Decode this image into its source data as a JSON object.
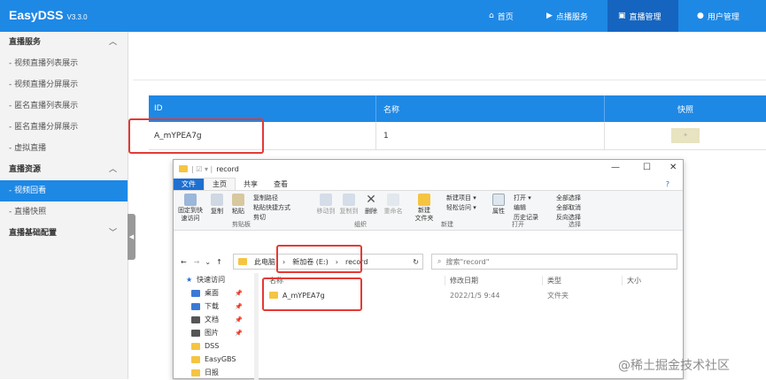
{
  "app": {
    "name": "EasyDSS",
    "version": "V3.3.0"
  },
  "nav": [
    {
      "label": "首页",
      "icon": "home-icon"
    },
    {
      "label": "点播服务",
      "icon": "video-icon"
    },
    {
      "label": "直播管理",
      "icon": "live-icon",
      "active": true
    },
    {
      "label": "用户管理",
      "icon": "user-icon"
    }
  ],
  "sidebar": {
    "sec1": "直播服务",
    "items1": [
      "- 视频直播列表展示",
      "- 视频直播分屏展示",
      "- 匿名直播列表展示",
      "- 匿名直播分屏展示",
      "- 虚拟直播"
    ],
    "sec2": "直播资源",
    "items2": [
      "- 视频回看",
      "- 直播快照"
    ],
    "sec3": "直播基础配置"
  },
  "table": {
    "headers": [
      "ID",
      "名称",
      "快照"
    ],
    "rows": [
      {
        "id": "A_mYPEA7g",
        "name": "1"
      }
    ]
  },
  "explorer": {
    "title": "record",
    "tabs": [
      "文件",
      "主页",
      "共享",
      "查看"
    ],
    "ribbon": {
      "pin": "固定到快\n速访问",
      "copy": "复制",
      "paste": "粘贴",
      "copy_path": "复制路径",
      "paste_shortcut": "粘贴快捷方式",
      "cut": "剪切",
      "move_to": "移动到",
      "copy_to": "复制到",
      "delete": "删除",
      "rename": "重命名",
      "new_folder": "新建\n文件夹",
      "new_item": "新建项目 ▾",
      "easy_access": "轻松访问 ▾",
      "properties": "属性",
      "open": "打开 ▾",
      "edit": "编辑",
      "history": "历史记录",
      "select_all": "全部选择",
      "select_none": "全部取消",
      "invert": "反向选择",
      "groups": [
        "剪贴板",
        "组织",
        "新建",
        "打开",
        "选择"
      ]
    },
    "address": [
      "此电脑",
      "新加卷 (E:)",
      "record"
    ],
    "search_placeholder": "搜索\"record\"",
    "nav_pane": [
      {
        "label": "快速访问",
        "icon": "star-icon"
      },
      {
        "label": "桌面",
        "icon": "desktop-icon"
      },
      {
        "label": "下载",
        "icon": "download-icon"
      },
      {
        "label": "文档",
        "icon": "document-icon"
      },
      {
        "label": "图片",
        "icon": "picture-icon"
      },
      {
        "label": "DSS",
        "icon": "folder-icon"
      },
      {
        "label": "EasyGBS",
        "icon": "folder-icon"
      },
      {
        "label": "日报",
        "icon": "folder-icon"
      }
    ],
    "columns": [
      "名称",
      "修改日期",
      "类型",
      "大小"
    ],
    "files": [
      {
        "name": "A_mYPEA7g",
        "date": "2022/1/5 9:44",
        "type": "文件夹",
        "size": ""
      }
    ]
  },
  "watermark": "@稀土掘金技术社区"
}
